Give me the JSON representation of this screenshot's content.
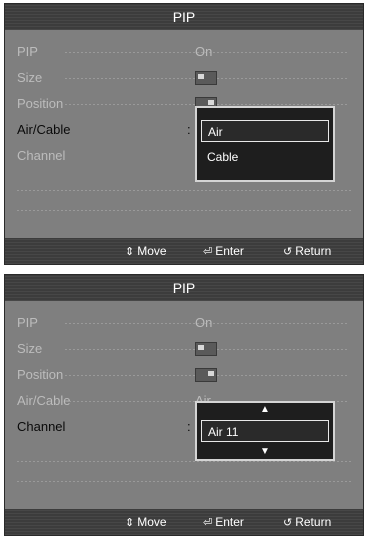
{
  "screens": [
    {
      "title": "PIP",
      "menu": [
        {
          "label": "PIP",
          "value": "On"
        },
        {
          "label": "Size",
          "value": ""
        },
        {
          "label": "Position",
          "value": ""
        },
        {
          "label": "Air/Cable",
          "value": ""
        },
        {
          "label": "Channel",
          "value": ""
        }
      ],
      "popup": {
        "options": [
          "Air",
          "Cable"
        ],
        "selected": "Air"
      },
      "footer": {
        "move": "Move",
        "enter": "Enter",
        "return": "Return"
      }
    },
    {
      "title": "PIP",
      "menu": [
        {
          "label": "PIP",
          "value": "On"
        },
        {
          "label": "Size",
          "value": ""
        },
        {
          "label": "Position",
          "value": ""
        },
        {
          "label": "Air/Cable",
          "value": "Air"
        },
        {
          "label": "Channel",
          "value": ""
        }
      ],
      "popup": {
        "options": [
          "Air 11"
        ],
        "selected": "Air 11"
      },
      "footer": {
        "move": "Move",
        "enter": "Enter",
        "return": "Return"
      }
    }
  ]
}
